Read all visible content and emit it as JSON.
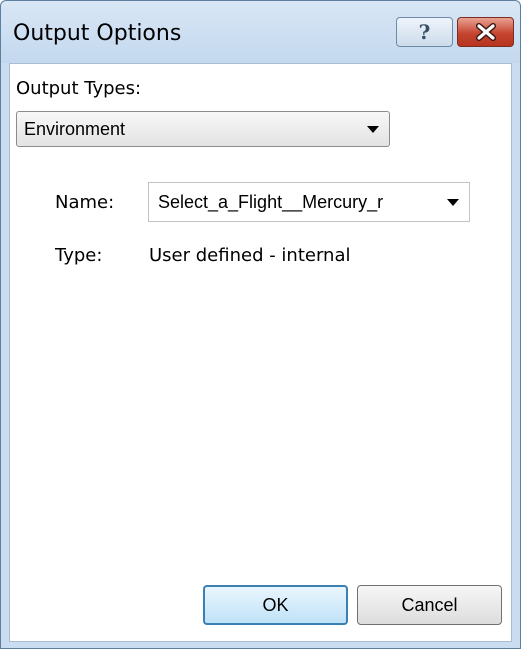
{
  "window": {
    "title": "Output Options",
    "help_icon": "help-icon",
    "help_glyph": "?",
    "close_icon": "close-icon"
  },
  "output_types": {
    "label": "Output Types:",
    "selected": "Environment"
  },
  "name_field": {
    "label": "Name:",
    "selected": "Select_a_Flight__Mercury_r"
  },
  "type_field": {
    "label": "Type:",
    "value": "User defined - internal"
  },
  "buttons": {
    "ok": "OK",
    "cancel": "Cancel"
  },
  "colors": {
    "title_bar": "#c9dcf0",
    "close_button": "#c54530",
    "default_button_border": "#3c7fb1"
  }
}
